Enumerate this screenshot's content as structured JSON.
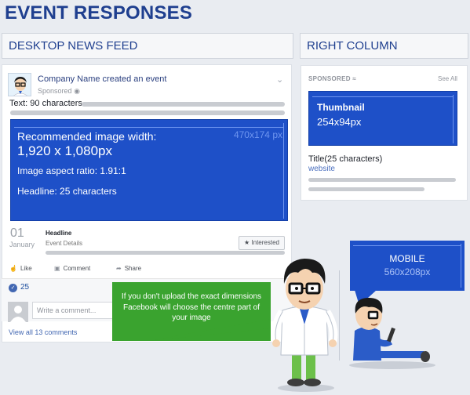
{
  "page_title": "EVENT RESPONSES",
  "sections": {
    "feed_title": "DESKTOP NEWS FEED",
    "right_title": "RIGHT COLUMN"
  },
  "post": {
    "title": "Company Name created an event",
    "sponsored": "Sponsored",
    "text_label": "Text: 90 characters",
    "image": {
      "dims": "470x174 px",
      "recommended_label": "Recommended image width:",
      "recommended_size": "1,920 x 1,080px",
      "aspect_ratio": "Image aspect ratio: 1.91:1",
      "headline": "Headline: 25 characters"
    },
    "event": {
      "day": "01",
      "month": "January",
      "headline": "Headline",
      "details": "Event Details",
      "interested": "Interested"
    },
    "actions": {
      "like": "Like",
      "comment": "Comment",
      "share": "Share"
    },
    "like_count": "25",
    "comment_placeholder": "Write a comment...",
    "view_all": "View all 13 comments"
  },
  "right_column": {
    "sponsored": "SPONSORED",
    "see_all": "See All",
    "thumbnail_title": "Thumbnail",
    "thumbnail_dims": "254x94px",
    "title_label": "Title(25 characters)",
    "website": "website"
  },
  "callout": "If you don't upload the exact dimensions Facebook will choose the centre part of your image",
  "mobile": {
    "title": "MOBILE",
    "dims": "560x208px"
  },
  "colors": {
    "brand_blue": "#1f3f8f",
    "image_blue": "#1e50c8",
    "callout_green": "#3aa32f",
    "facebook_blue": "#4267b2"
  }
}
